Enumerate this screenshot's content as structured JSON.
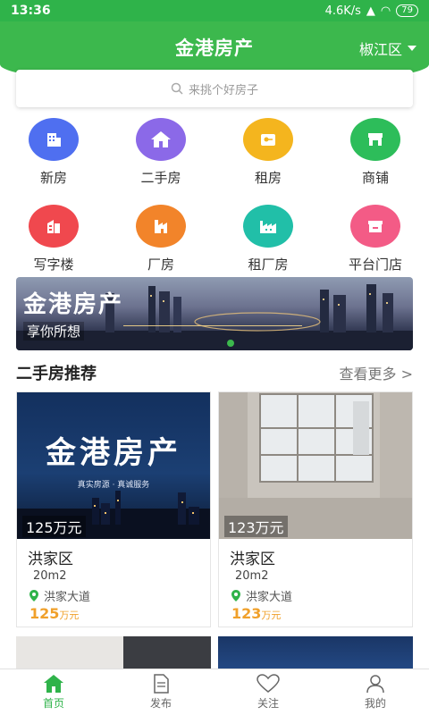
{
  "status_bar": {
    "time": "13:36",
    "network": "4.6K/s",
    "battery": "79"
  },
  "header": {
    "brand": "金港房产",
    "city": "椒江区"
  },
  "search": {
    "placeholder": "来挑个好房子"
  },
  "categories": [
    {
      "label": "新房",
      "icon": "building-icon",
      "color": "#4f6ff0"
    },
    {
      "label": "二手房",
      "icon": "house-icon",
      "color": "#8b69e8"
    },
    {
      "label": "租房",
      "icon": "key-icon",
      "color": "#f4b51e"
    },
    {
      "label": "商铺",
      "icon": "shop-icon",
      "color": "#2dbd5a"
    },
    {
      "label": "写字楼",
      "icon": "office-icon",
      "color": "#f0484e"
    },
    {
      "label": "厂房",
      "icon": "factory-icon",
      "color": "#f2842a"
    },
    {
      "label": "租厂房",
      "icon": "factory-rent-icon",
      "color": "#21bfa8"
    },
    {
      "label": "平台门店",
      "icon": "store-icon",
      "color": "#f35b86"
    }
  ],
  "banner": {
    "title": "金港房产",
    "subtitle": "享你所想"
  },
  "section": {
    "title": "二手房推荐",
    "more": "查看更多 >"
  },
  "listings": [
    {
      "image_text": "金港房产",
      "image_caption": "真实房源 · 真诚服务",
      "price_tag": "125万元",
      "district": "洪家区",
      "area": "20m2",
      "road": "洪家大道",
      "price": "125",
      "unit": "万元"
    },
    {
      "price_tag": "123万元",
      "district": "洪家区",
      "area": "20m2",
      "road": "洪家大道",
      "price": "123",
      "unit": "万元"
    }
  ],
  "tabs": [
    {
      "label": "首页",
      "icon": "home-icon",
      "active": true
    },
    {
      "label": "发布",
      "icon": "document-icon",
      "active": false
    },
    {
      "label": "关注",
      "icon": "heart-icon",
      "active": false
    },
    {
      "label": "我的",
      "icon": "person-icon",
      "active": false
    }
  ],
  "colors": {
    "brand_green": "#3cb84d",
    "price_orange": "#f0a02a"
  }
}
